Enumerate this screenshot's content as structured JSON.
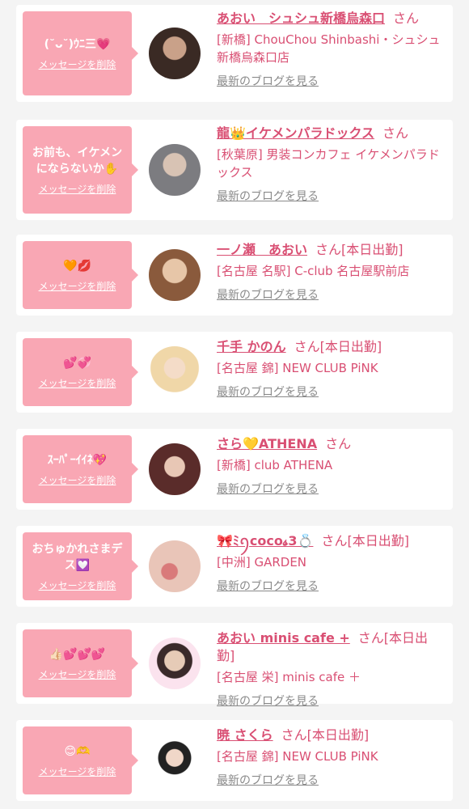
{
  "items": [
    {
      "message": "(˘ᴗ˘)ｳﾆ三💗",
      "delete": "メッセージを削除",
      "name": "あおい　シュシュ新橋烏森口",
      "san": "さん",
      "status": "",
      "shop": "[新橋] ChouChou Shinbashi・シュシュ新橋烏森口店",
      "blog": "最新のブログを見る"
    },
    {
      "message": "お前も、イケメンにならないか✋",
      "delete": "メッセージを削除",
      "name": "龍👑イケメンパラドックス",
      "san": "さん",
      "status": "",
      "shop": "[秋葉原] 男装コンカフェ イケメンパラドックス",
      "blog": "最新のブログを見る"
    },
    {
      "message": "🧡💋",
      "delete": "メッセージを削除",
      "name": "一ノ瀬　あおい",
      "san": "さん",
      "status": "[本日出勤]",
      "shop": "[名古屋 名駅] C-club 名古屋駅前店",
      "blog": "最新のブログを見る"
    },
    {
      "message": "💕💞",
      "delete": "メッセージを削除",
      "name": "千手 かのん",
      "san": "さん",
      "status": "[本日出勤]",
      "shop": "[名古屋 錦] NEW CLUB PiNK",
      "blog": "最新のブログを見る"
    },
    {
      "message": "ｽｰﾊﾟｰｲｲﾈ💖",
      "delete": "メッセージを削除",
      "name": "さら💛ATHENA",
      "san": "さん",
      "status": "",
      "shop": "[新橋] club ATHENA",
      "blog": "最新のブログを見る"
    },
    {
      "message": "おちゅかれさまデス💟",
      "delete": "メッセージを削除",
      "name": "🎀ﾐꪆcoco𝓼3💍",
      "san": "さん",
      "status": "[本日出勤]",
      "shop": "[中洲] GARDEN",
      "blog": "最新のブログを見る"
    },
    {
      "message": "👍🏻💕💕💕",
      "delete": "メッセージを削除",
      "name": "あおい minis cafe +",
      "san": "さん",
      "status": "[本日出勤]",
      "shop": "[名古屋 栄] minis cafe ＋",
      "blog": "最新のブログを見る"
    },
    {
      "message": "😊🫶",
      "delete": "メッセージを削除",
      "name": "暁 さくら",
      "san": "さん",
      "status": "[本日出勤]",
      "shop": "[名古屋 錦] NEW CLUB PiNK",
      "blog": "最新のブログを見る"
    }
  ]
}
